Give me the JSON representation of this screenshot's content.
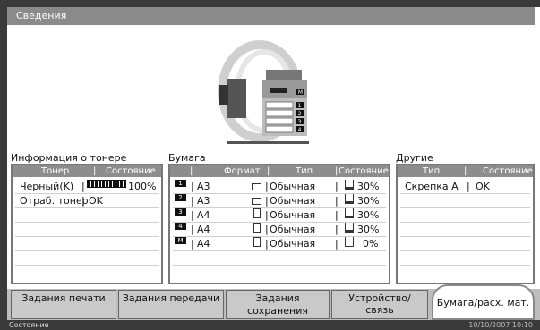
{
  "window": {
    "title": "Сведения"
  },
  "copier": {
    "labels": [
      "M",
      "1",
      "2",
      "3",
      "4"
    ]
  },
  "toner": {
    "title": "Информация о тонере",
    "headers": [
      "Тонер",
      "Состояние"
    ],
    "rows": [
      {
        "name": "Черный(K)",
        "status": "100%",
        "level": 1.0
      },
      {
        "name": "Отраб. тонер",
        "status": "OK"
      }
    ]
  },
  "paper": {
    "title": "Бумага",
    "headers": [
      "Формат",
      "Тип",
      "Состояние"
    ],
    "rows": [
      {
        "tray": "1",
        "format": "A3",
        "type": "Обычная",
        "state": "30%"
      },
      {
        "tray": "2",
        "format": "A3",
        "type": "Обычная",
        "state": "30%"
      },
      {
        "tray": "3",
        "format": "A4",
        "type": "Обычная",
        "state": "30%"
      },
      {
        "tray": "4",
        "format": "A4",
        "type": "Обычная",
        "state": "30%"
      },
      {
        "tray": "M",
        "format": "A4",
        "type": "Обычная",
        "state": "0%"
      }
    ]
  },
  "other": {
    "title": "Другие",
    "headers": [
      "Тип",
      "Состояние"
    ],
    "rows": [
      {
        "type": "Скрепка A",
        "state": "OK"
      }
    ]
  },
  "tabs": [
    {
      "label": "Задания печати"
    },
    {
      "label": "Задания передачи"
    },
    {
      "label": "Задания сохранения"
    },
    {
      "label": "Устройство/ связь"
    },
    {
      "label": "Бумага/расх. мат."
    }
  ],
  "status": {
    "label": "Состояние",
    "datetime": "10/10/2007 10:10"
  }
}
